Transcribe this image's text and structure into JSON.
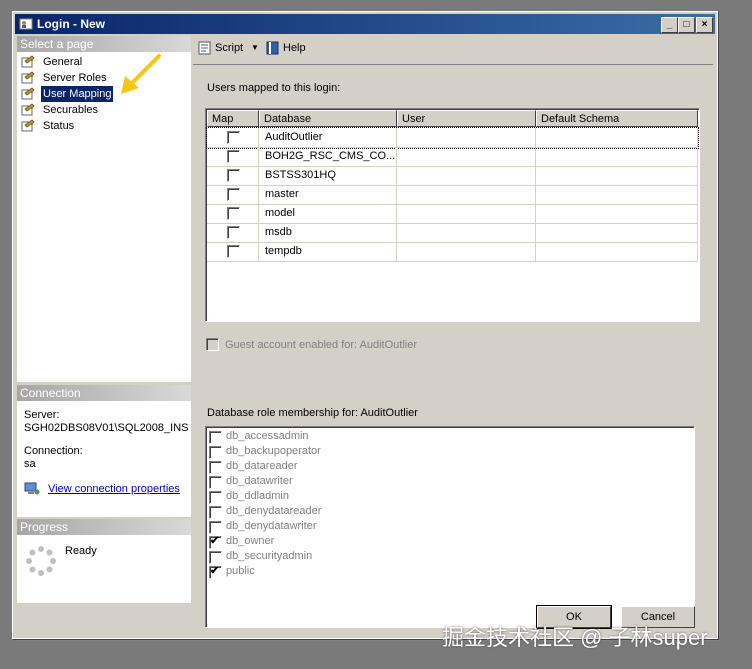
{
  "window": {
    "title": "Login - New"
  },
  "left": {
    "select_page_header": "Select a page",
    "pages": [
      {
        "label": "General",
        "selected": false
      },
      {
        "label": "Server Roles",
        "selected": false
      },
      {
        "label": "User Mapping",
        "selected": true
      },
      {
        "label": "Securables",
        "selected": false
      },
      {
        "label": "Status",
        "selected": false
      }
    ],
    "connection_header": "Connection",
    "server_label": "Server:",
    "server_value": "SGH02DBS08V01\\SQL2008_INS",
    "connection_label": "Connection:",
    "connection_value": "sa",
    "view_connection_link": "View connection properties",
    "progress_header": "Progress",
    "progress_status": "Ready"
  },
  "toolbar": {
    "script_label": "Script",
    "help_label": "Help"
  },
  "mapping": {
    "users_mapped_label": "Users mapped to this login:",
    "columns": [
      "Map",
      "Database",
      "User",
      "Default Schema"
    ],
    "rows": [
      {
        "map": false,
        "database": "AuditOutlier",
        "user": "",
        "schema": ""
      },
      {
        "map": false,
        "database": "BOH2G_RSC_CMS_CO...",
        "user": "",
        "schema": ""
      },
      {
        "map": false,
        "database": "BSTSS301HQ",
        "user": "",
        "schema": ""
      },
      {
        "map": false,
        "database": "master",
        "user": "",
        "schema": ""
      },
      {
        "map": false,
        "database": "model",
        "user": "",
        "schema": ""
      },
      {
        "map": false,
        "database": "msdb",
        "user": "",
        "schema": ""
      },
      {
        "map": false,
        "database": "tempdb",
        "user": "",
        "schema": ""
      }
    ],
    "guest_label": "Guest account enabled for: AuditOutlier",
    "role_membership_label": "Database role membership for: AuditOutlier",
    "roles": [
      {
        "name": "db_accessadmin",
        "checked": false
      },
      {
        "name": "db_backupoperator",
        "checked": false
      },
      {
        "name": "db_datareader",
        "checked": false
      },
      {
        "name": "db_datawriter",
        "checked": false
      },
      {
        "name": "db_ddladmin",
        "checked": false
      },
      {
        "name": "db_denydatareader",
        "checked": false
      },
      {
        "name": "db_denydatawriter",
        "checked": false
      },
      {
        "name": "db_owner",
        "checked": true
      },
      {
        "name": "db_securityadmin",
        "checked": false
      },
      {
        "name": "public",
        "checked": true
      }
    ]
  },
  "buttons": {
    "ok_label": "OK",
    "cancel_label": "Cancel"
  },
  "watermark": "掘金技术社区 @ 子林super",
  "colors": {
    "accent_arrow": "#f5c518",
    "title_bar": "#0a246a",
    "selection": "#0a246a"
  }
}
